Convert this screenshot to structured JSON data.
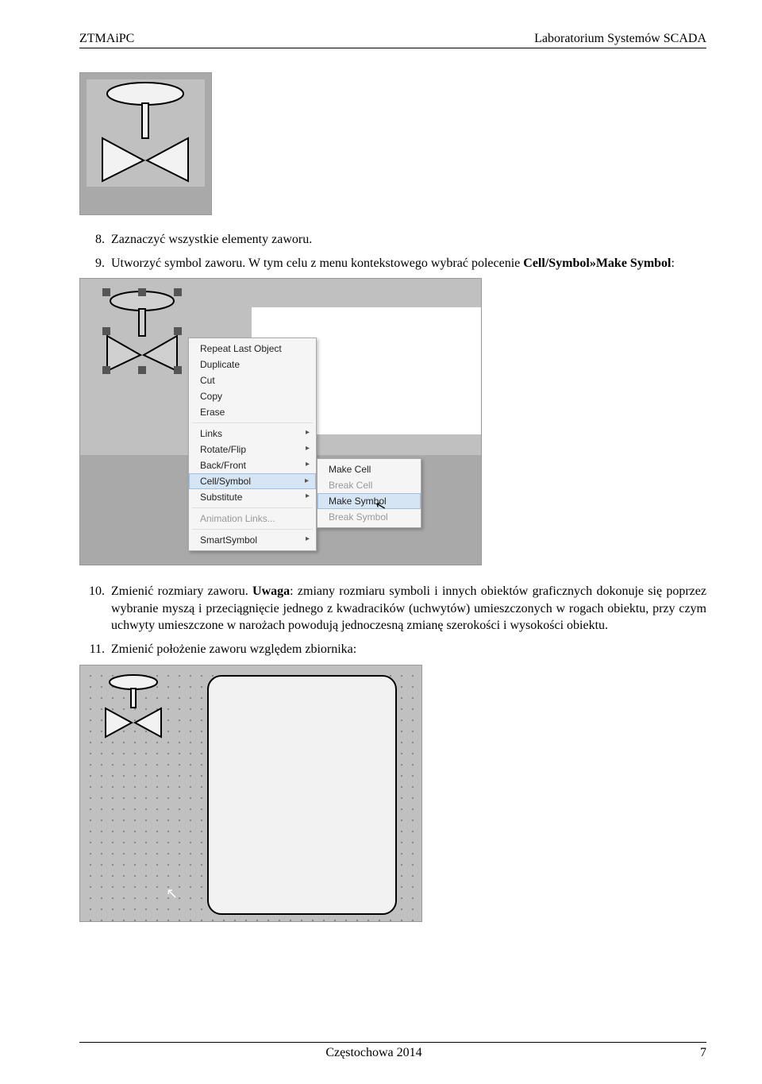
{
  "header": {
    "left": "ZTMAiPC",
    "right": "Laboratorium Systemów SCADA"
  },
  "items": {
    "n8": {
      "num": "8.",
      "text": "Zaznaczyć wszystkie elementy zaworu."
    },
    "n9": {
      "num": "9.",
      "pre": "Utworzyć symbol zaworu. W tym celu z menu kontekstowego wybrać polecenie ",
      "bold": "Cell/Symbol»Make Symbol",
      "post": ":"
    },
    "n10": {
      "num": "10.",
      "pre": "Zmienić rozmiary zaworu. ",
      "bold": "Uwaga",
      "post": ": zmiany rozmiaru symboli i innych obiektów graficznych dokonuje się poprzez wybranie myszą i przeciągnięcie jednego z kwadracików (uchwytów) umieszczonych w rogach obiektu, przy czym uchwyty umieszczone w narożach powodują jednoczesną zmianę szerokości i wysokości obiektu."
    },
    "n11": {
      "num": "11.",
      "text": "Zmienić położenie zaworu względem zbiornika:"
    }
  },
  "menu1": {
    "repeat": "Repeat Last Object",
    "duplicate": "Duplicate",
    "cut": "Cut",
    "copy": "Copy",
    "erase": "Erase",
    "links": "Links",
    "rotate": "Rotate/Flip",
    "backfront": "Back/Front",
    "cellsymbol": "Cell/Symbol",
    "substitute": "Substitute",
    "anim": "Animation Links...",
    "smart": "SmartSymbol"
  },
  "menu2": {
    "makecell": "Make Cell",
    "breakcell": "Break Cell",
    "makesymbol": "Make Symbol",
    "breaksymbol": "Break Symbol"
  },
  "footer": {
    "center": "Częstochowa 2014",
    "pagenum": "7"
  }
}
